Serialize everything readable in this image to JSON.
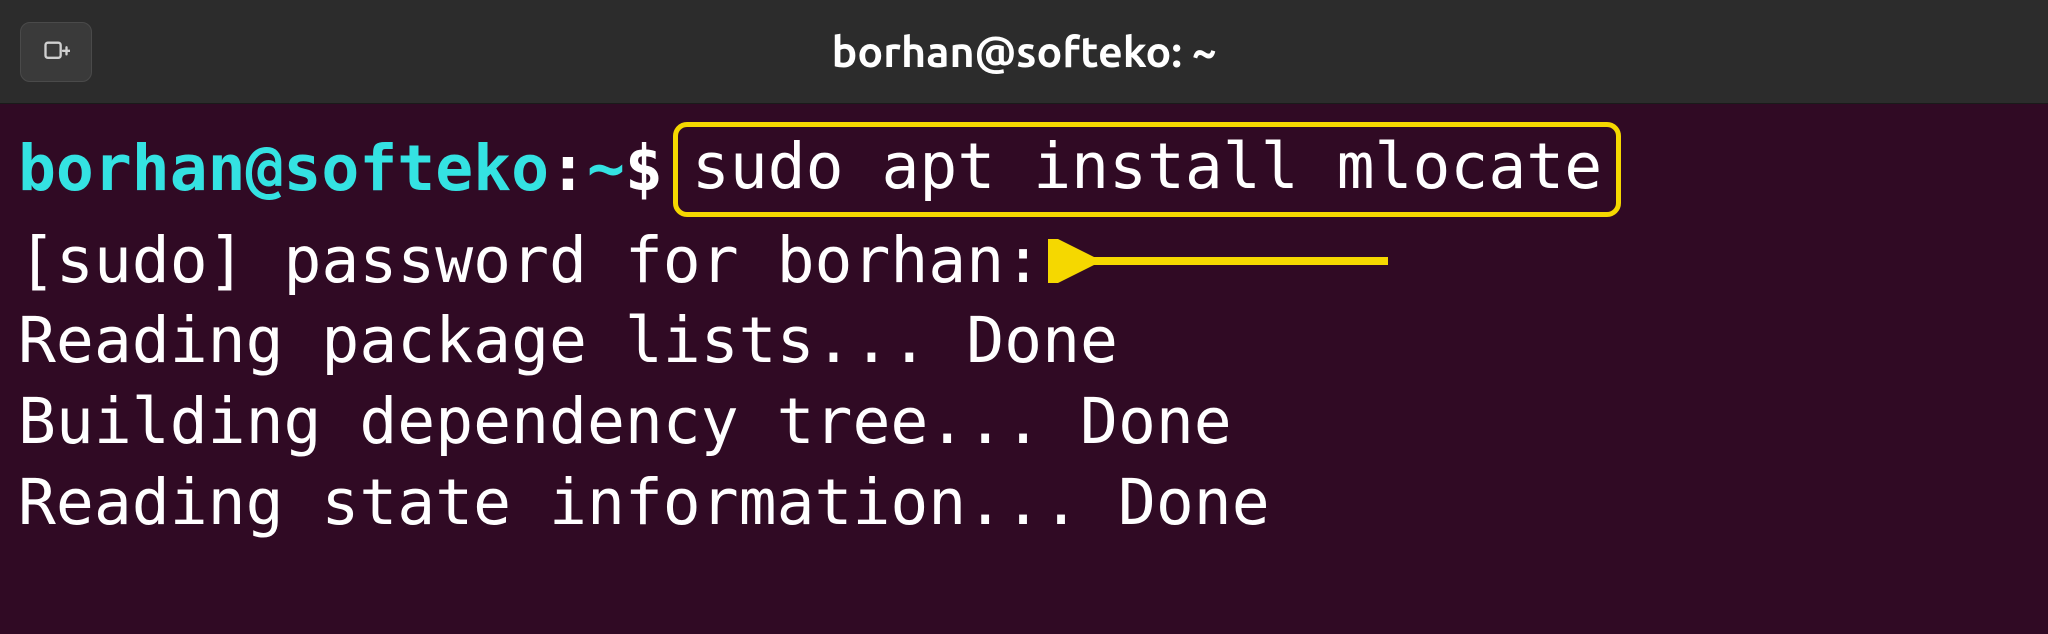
{
  "window": {
    "title": "borhan@softeko: ~"
  },
  "prompt": {
    "user_host": "borhan@softeko",
    "separator": ":",
    "path": "~",
    "symbol": "$"
  },
  "command": "sudo apt install mlocate",
  "output": {
    "line2": "[sudo] password for borhan:",
    "line3": "Reading package lists... Done",
    "line4": "Building dependency tree... Done",
    "line5": "Reading state information... Done"
  },
  "colors": {
    "bg": "#300a24",
    "titlebar": "#2c2c2c",
    "highlight": "#f5d800",
    "cyan": "#34e2e2",
    "text": "#ffffff"
  }
}
